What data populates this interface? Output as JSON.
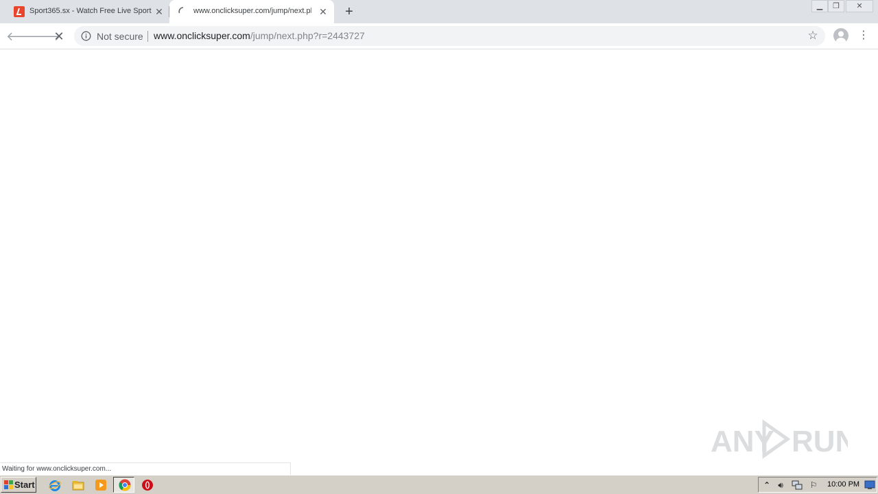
{
  "browser": {
    "tabs": [
      {
        "title": "Sport365.sx - Watch Free Live Sport",
        "favicon": "sport365-favicon",
        "active": false
      },
      {
        "title": "www.onclicksuper.com/jump/next.php",
        "favicon": "loading-spinner-icon",
        "active": true
      }
    ],
    "new_tab_label": "+",
    "toolbar": {
      "security_label": "Not secure",
      "url_host": "www.onclicksuper.com",
      "url_path": "/jump/next.php?r=2443727"
    },
    "status_text": "Waiting for www.onclicksuper.com..."
  },
  "watermark": {
    "text": "ANY RUN"
  },
  "taskbar": {
    "start_label": "Start",
    "clock": "10:00 PM",
    "pinned": [
      "internet-explorer-icon",
      "file-explorer-icon",
      "media-player-icon",
      "chrome-icon",
      "opera-icon"
    ]
  },
  "colors": {
    "tabstrip_bg": "#dee1e6",
    "omnibox_bg": "#f1f3f4",
    "taskbar_bg": "#d4d0c8",
    "sport365_brand": "#e8452c"
  }
}
